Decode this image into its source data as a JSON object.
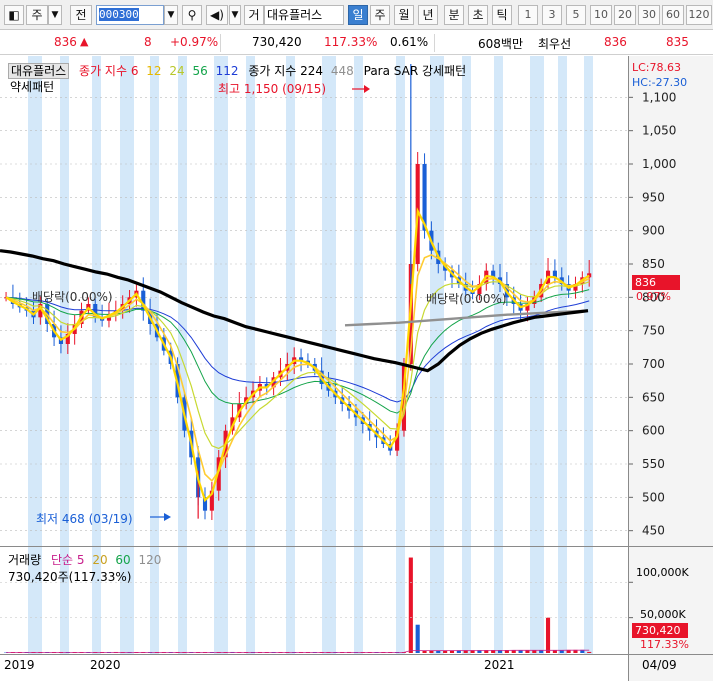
{
  "toolbar": {
    "icon_chart": "chart-icon",
    "type_label": "주",
    "prev_label": "전",
    "code": "000300",
    "search_icon": "search-icon",
    "speaker_icon": "speaker-icon",
    "mode_label": "거",
    "stock_name": "대유플러스",
    "periods": [
      "일",
      "주",
      "월",
      "년",
      "분",
      "초",
      "틱"
    ],
    "active_period": "일",
    "numbers": [
      "1",
      "3",
      "5",
      "10",
      "20",
      "30",
      "60",
      "120"
    ]
  },
  "quote": {
    "price": "836",
    "change_arrow": "▲",
    "change": "8",
    "change_pct": "+0.97%",
    "volume": "730,420",
    "volume_ratio": "117.33%",
    "turnover": "0.61%",
    "amount": "608백만",
    "best_label": "최우선",
    "ask": "836",
    "bid": "835"
  },
  "legend": {
    "name": "대유플러스",
    "ma_label": "종가 지수 6",
    "ma12": "12",
    "ma24": "24",
    "ma56": "56",
    "ma112": "112",
    "ma224": "종가 지수 224",
    "ma448": "448",
    "sar": "Para SAR 강세패턴",
    "pattern": "약세패턴",
    "lc": "LC:78.63",
    "hc": "HC:-27.30"
  },
  "annotations": {
    "high": "최고 1,150 (09/15)",
    "low": "최저 468 (03/19)",
    "dividend1": "배당락(0.00%)",
    "dividend2": "배당락(0.00%)"
  },
  "price_axis": {
    "ticks": [
      "1,100",
      "1,050",
      "1,000",
      "950",
      "900",
      "850",
      "800",
      "750",
      "700",
      "650",
      "600",
      "550",
      "500",
      "450"
    ],
    "current": "836",
    "current_pct": "0.97%"
  },
  "volume_panel": {
    "label": "거래량",
    "ma_label": "단순 5",
    "ma20": "20",
    "ma60": "60",
    "ma120": "120",
    "value": "730,420주(117.33%)",
    "axis_ticks": [
      "100,000K",
      "50,000K"
    ],
    "current": "730,420",
    "current_pct": "117.33%"
  },
  "date_axis": {
    "labels": [
      "2019",
      "2020",
      "2021",
      "04/09"
    ]
  },
  "colors": {
    "up": "#e8142a",
    "down": "#1a5fd6",
    "ma6": "#ffd700",
    "ma12": "#ffcc33",
    "ma24": "#c8d932",
    "ma56": "#14a44a",
    "ma112": "#1e3dd6",
    "ma224": "#000000",
    "ma448": "#909090",
    "band": "#cfe6f8"
  },
  "chart_data": {
    "type": "line",
    "title": "",
    "ylim": [
      430,
      1150
    ],
    "y_ticks": [
      1100,
      1050,
      1000,
      950,
      900,
      850,
      800,
      750,
      700,
      650,
      600,
      550,
      500,
      450
    ],
    "x_labels": [
      "2019",
      "2020",
      "2021",
      "04/09"
    ],
    "high": {
      "value": 1150,
      "date": "09/15"
    },
    "low": {
      "value": 468,
      "date": "03/19"
    },
    "last_close": 836,
    "close": [
      800,
      790,
      785,
      780,
      770,
      790,
      760,
      740,
      730,
      745,
      760,
      780,
      790,
      770,
      765,
      775,
      780,
      790,
      800,
      810,
      780,
      760,
      740,
      720,
      700,
      650,
      600,
      560,
      500,
      480,
      510,
      560,
      600,
      620,
      640,
      650,
      660,
      670,
      665,
      680,
      690,
      700,
      710,
      705,
      700,
      690,
      670,
      660,
      650,
      640,
      630,
      620,
      610,
      600,
      590,
      580,
      570,
      600,
      700,
      850,
      1000,
      900,
      870,
      850,
      840,
      830,
      820,
      810,
      805,
      820,
      840,
      830,
      820,
      800,
      790,
      780,
      790,
      800,
      820,
      840,
      830,
      820,
      810,
      820,
      830,
      836
    ],
    "ma224": [
      870,
      868,
      865,
      862,
      858,
      855,
      850,
      846,
      842,
      838,
      835,
      830,
      826,
      820,
      814,
      808,
      800,
      792,
      785,
      778,
      772,
      768,
      762,
      756,
      752,
      748,
      744,
      740,
      736,
      732,
      728,
      724,
      720,
      716,
      712,
      708,
      705,
      702,
      698,
      694,
      690,
      700,
      715,
      728,
      738,
      746,
      752,
      757,
      762,
      766,
      770,
      772,
      774,
      776,
      778,
      780
    ],
    "ma448": [
      758,
      760,
      762,
      765,
      768,
      771,
      774,
      776,
      778,
      780
    ],
    "volume_peaks_k": [
      135000,
      50000
    ]
  }
}
